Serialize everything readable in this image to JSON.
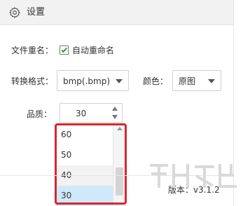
{
  "header": {
    "title": "设置",
    "icon": "gear-icon"
  },
  "rename": {
    "label": "文件重名：",
    "checkbox_label": "自动重命名",
    "checked": true
  },
  "format": {
    "label": "转换格式：",
    "value": "bmp(.bmp)"
  },
  "color": {
    "label": "颜色：",
    "value": "原图"
  },
  "quality": {
    "label": "品质：",
    "value": "30",
    "options": [
      "60",
      "50",
      "40",
      "30"
    ],
    "hovered": "40",
    "selected": "30"
  },
  "footer": {
    "version": "版本：v3.1.2"
  },
  "colors": {
    "highlight": "#d6282e",
    "selected_bg": "#cfe8fa",
    "header_bg": "#f2f2f2"
  }
}
